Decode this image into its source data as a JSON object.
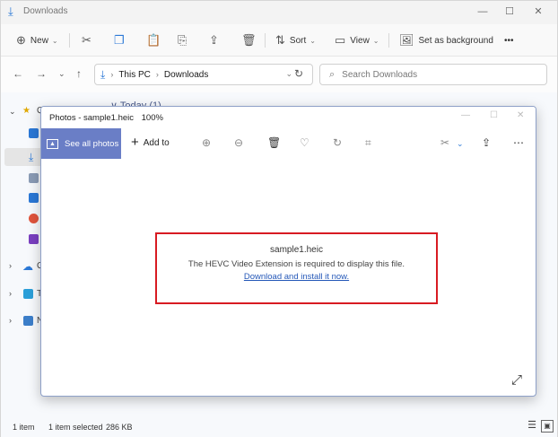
{
  "explorer": {
    "title": "Downloads",
    "toolbar": {
      "new_label": "New",
      "sort_label": "Sort",
      "view_label": "View",
      "set_background_label": "Set as background",
      "more_label": "•••"
    },
    "address": {
      "crumbs": [
        "This PC",
        "Downloads"
      ],
      "search_placeholder": "Search Downloads"
    },
    "section_header": "∨ Today (1)",
    "sidebar": {
      "quick_access_partial": "Q",
      "onedrive_partial": "O",
      "thispc_partial": "T",
      "network_partial": "N"
    },
    "status": {
      "item_count": "1 item",
      "selected": "1 item selected",
      "size": "286 KB"
    }
  },
  "photos": {
    "title": "Photos - sample1.heic",
    "zoom": "100%",
    "see_all_label": "See all photos",
    "add_to_label": "Add to",
    "error": {
      "filename": "sample1.heic",
      "message": "The HEVC Video Extension is required to display this file.",
      "link": "Download and install it now."
    }
  },
  "colors": {
    "accent": "#6a7ec6",
    "error_border": "#d81b22",
    "link": "#2558b8"
  }
}
